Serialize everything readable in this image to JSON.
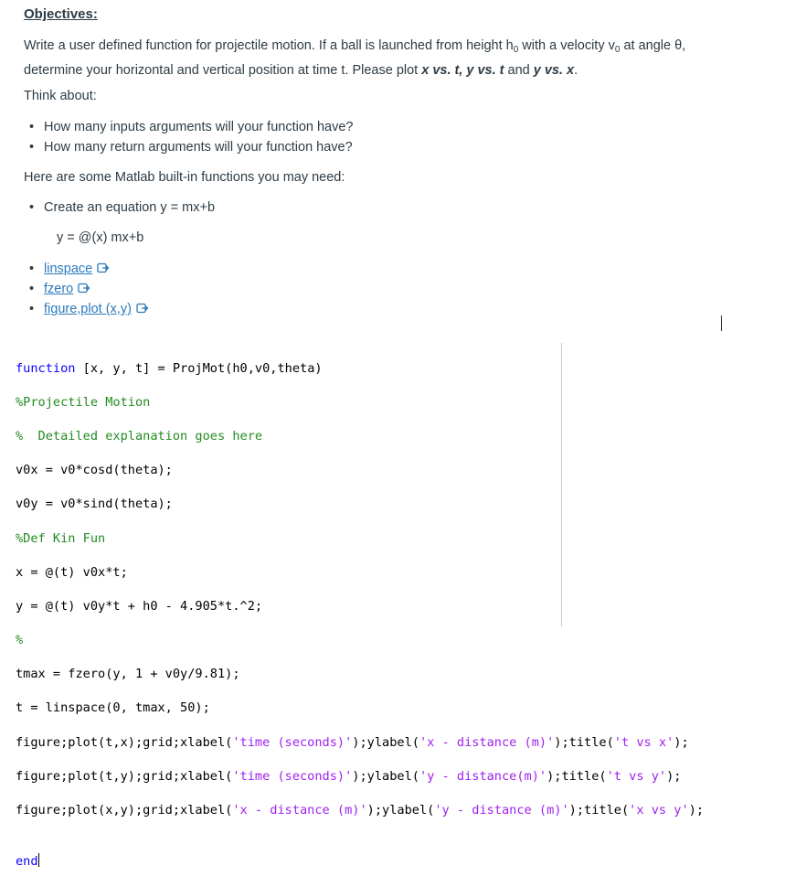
{
  "heading": "Objectives:",
  "intro": {
    "part1": "Write a user defined function for projectile motion. If a ball is launched from height h",
    "h_sub": "0",
    "part2": " with a velocity v",
    "v_sub": "0",
    "part3": " at angle θ,",
    "line2_part1": "determine your horizontal and vertical position at time t. Please plot ",
    "plot1": "x vs. t, y vs. t",
    "and": " and ",
    "plot2": "y vs. x",
    "end": "."
  },
  "think_about": "Think about:",
  "questions": [
    "How many inputs arguments will your function have?",
    "How many return arguments will your function have?"
  ],
  "builtins_intro": "Here are some Matlab built-in functions you may need:",
  "equation_item": "Create an equation y = mx+b",
  "equation": "y = @(x) mx+b",
  "links": [
    "linspace",
    "fzero",
    "figure,plot (x,y)"
  ],
  "icons": {
    "external_link": "external-link-icon",
    "bullet": "•"
  },
  "code": {
    "l1_kw": "function",
    "l1_rest": " [x, y, t] = ProjMot(h0,v0,theta)",
    "l2": "%Projectile Motion",
    "l3": "%  Detailed explanation goes here",
    "l4": "v0x = v0*cosd(theta);",
    "l5": "v0y = v0*sind(theta);",
    "l6": "%Def Kin Fun",
    "l7": "x = @(t) v0x*t;",
    "l8": "y = @(t) v0y*t + h0 - 4.905*t.^2;",
    "l9": "%",
    "l10": "tmax = fzero(y, 1 + v0y/9.81);",
    "l11": "t = linspace(0, tmax, 50);",
    "l12_a": "figure;plot(t,x);grid;xlabel(",
    "l12_s1": "'time (seconds)'",
    "l12_b": ");ylabel(",
    "l12_s2": "'x - distance (m)'",
    "l12_c": ");title(",
    "l12_s3": "'t vs x'",
    "l12_d": ");",
    "l13_a": "figure;plot(t,y);grid;xlabel(",
    "l13_s1": "'time (seconds)'",
    "l13_b": ");ylabel(",
    "l13_s2": "'y - distance(m)'",
    "l13_c": ");title(",
    "l13_s3": "'t vs y'",
    "l13_d": ");",
    "l14_a": "figure;plot(x,y);grid;xlabel(",
    "l14_s1": "'x - distance (m)'",
    "l14_b": ");ylabel(",
    "l14_s2": "'y - distance (m)'",
    "l14_c": ");title(",
    "l14_s3": "'x vs y'",
    "l14_d": ");",
    "end_kw": "end"
  },
  "colors": {
    "keyword": "#0e00ff",
    "comment": "#228b22",
    "string": "#a020f0",
    "link": "#2b7abc",
    "text": "#2d3b45"
  }
}
